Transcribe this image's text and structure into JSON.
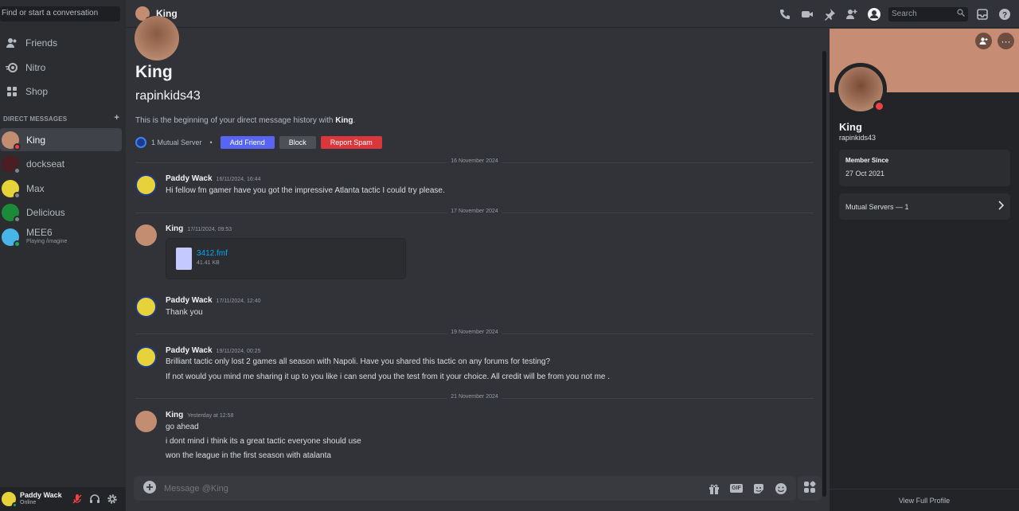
{
  "sidebar": {
    "find_placeholder": "Find or start a conversation",
    "nav": [
      {
        "label": "Friends",
        "icon": "friends-icon"
      },
      {
        "label": "Nitro",
        "icon": "nitro-icon"
      },
      {
        "label": "Shop",
        "icon": "shop-icon"
      }
    ],
    "dm_header": "DIRECT MESSAGES",
    "dm_add": "+",
    "dms": [
      {
        "name": "King",
        "status": "dnd",
        "active": true
      },
      {
        "name": "dockseat",
        "status": "offline"
      },
      {
        "name": "Max",
        "status": "offline"
      },
      {
        "name": "Delicious",
        "status": "offline"
      },
      {
        "name": "MEE6",
        "sub": "Playing /imagine",
        "status": "online"
      }
    ]
  },
  "user_bar": {
    "name": "Paddy Wack",
    "status": "Online"
  },
  "topbar": {
    "title": "King",
    "search_placeholder": "Search"
  },
  "intro": {
    "name": "King",
    "handle": "rapinkids43",
    "text_prefix": "This is the beginning of your direct message history with ",
    "text_name": "King",
    "text_suffix": ".",
    "mutual": "1 Mutual Server",
    "sep": "•",
    "add_friend": "Add Friend",
    "block": "Block",
    "report": "Report Spam"
  },
  "dividers": [
    "16 November 2024",
    "17 November 2024",
    "19 November 2024",
    "21 November 2024"
  ],
  "messages": [
    {
      "author": "Paddy Wack",
      "time": "16/11/2024, 16:44",
      "lines": [
        "Hi fellow fm gamer have you got the impressive Atlanta tactic I could try please."
      ]
    },
    {
      "author": "King",
      "time": "17/11/2024, 09:53",
      "attachment": {
        "name": "3412.fmf",
        "size": "41.41 KB"
      }
    },
    {
      "author": "Paddy Wack",
      "time": "17/11/2024, 12:40",
      "lines": [
        "Thank you"
      ]
    },
    {
      "author": "Paddy Wack",
      "time": "19/11/2024, 00:25",
      "lines": [
        "Brilliant tactic only lost 2 games all season with Napoli. Have you shared this tactic on any forums for testing?",
        "If not would you mind me sharing it up to you like i can send you the test from it your choice. All credit will be from you not me ."
      ]
    },
    {
      "author": "King",
      "time": "Yesterday at 12:58",
      "lines": [
        "go ahead",
        "i dont mind i think its a great tactic everyone should use",
        "won the league in the first season with atalanta"
      ]
    }
  ],
  "composer": {
    "placeholder": "Message @King",
    "gif": "GIF"
  },
  "profile": {
    "name": "King",
    "handle": "rapinkids43",
    "member_since_label": "Member Since",
    "member_since": "27 Oct 2021",
    "mutual_servers": "Mutual Servers — 1",
    "footer": "View Full Profile",
    "more": "···"
  },
  "colors": {
    "accent": "#5865f2",
    "danger": "#da373c",
    "online": "#23a559",
    "dnd": "#f23f43",
    "banner": "#c68d74"
  }
}
